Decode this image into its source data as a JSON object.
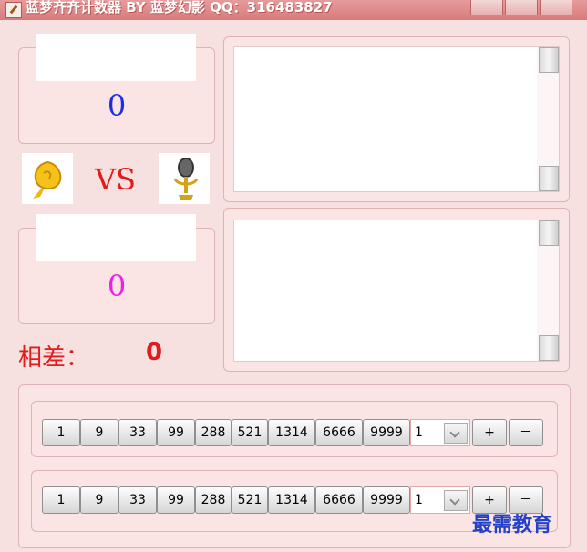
{
  "window": {
    "title": "蓝梦齐齐计数器 BY 蓝梦幻影 QQ：316483827"
  },
  "team1": {
    "name": "",
    "score": "0"
  },
  "team2": {
    "name": "",
    "score": "0"
  },
  "vs_label": "VS",
  "avatars": {
    "left": "rose-icon",
    "right": "microphone-icon"
  },
  "difference": {
    "label": "相差：",
    "value": "0"
  },
  "quick_buttons": [
    "1",
    "9",
    "33",
    "99",
    "288",
    "521",
    "1314",
    "6666",
    "9999"
  ],
  "rows": [
    {
      "combo_value": "1",
      "plus": "+",
      "minus": "－"
    },
    {
      "combo_value": "1",
      "plus": "+",
      "minus": "－"
    }
  ],
  "watermark": "最需教育",
  "colors": {
    "team1_score": "#1b2ee8",
    "team2_score": "#f01ee9",
    "accent_red": "#e21b1b"
  }
}
